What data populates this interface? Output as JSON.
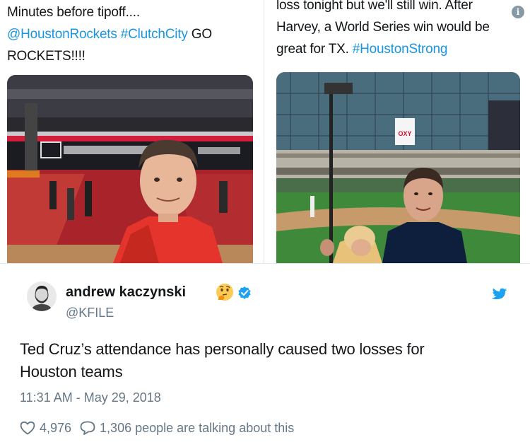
{
  "left_embed": {
    "line1": "Minutes before tipoff....",
    "line2_link": "@HoustonRockets #ClutchCity",
    "line2_rest": " GO",
    "line3": "ROCKETS!!!!"
  },
  "right_embed": {
    "line1": "loss tonight but we'll still win. After",
    "line2": "Harvey, a World Series win would be",
    "line3_plain": "great for TX. ",
    "line3_link": "#HoustonStrong",
    "stadium_sign": "OXY"
  },
  "tweet": {
    "author_name": "andrew kaczynski",
    "handle": "@KFILE",
    "text_line1": "Ted Cruz’s attendance has personally caused two losses for",
    "text_line2": "Houston teams",
    "timestamp": "11:31 AM - May 29, 2018",
    "likes": "4,976",
    "talking": "1,306 people are talking about this"
  },
  "icons": {
    "info": "info-icon",
    "verified": "verified-badge-icon",
    "bird": "twitter-bird-icon",
    "heart": "heart-icon",
    "reply": "reply-bubble-icon",
    "emoji": "thinking-face-emoji"
  },
  "colors": {
    "link": "#1b95e0",
    "secondary_text": "#657786",
    "primary_text": "#14171a",
    "brand": "#1da1f2"
  }
}
